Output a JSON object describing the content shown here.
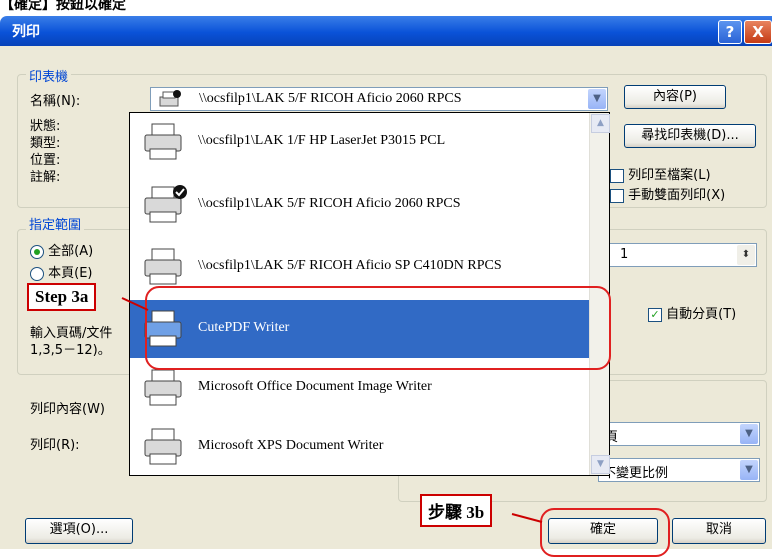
{
  "instruction_text": "【確定】按鈕以確定",
  "window": {
    "title": "列印",
    "help_btn": "?",
    "close_btn": "X"
  },
  "printer_group": {
    "title": "印表機",
    "name_label": "名稱(N):",
    "selected_printer": "\\\\ocsfilp1\\LAK 5/F RICOH Aficio 2060 RPCS",
    "properties_button": "內容(P)",
    "find_printer_button": "尋找印表機(D)...",
    "status_label": "狀態:",
    "type_label": "類型:",
    "location_label": "位置:",
    "comment_label": "註解:",
    "print_to_file": "列印至檔案(L)",
    "manual_duplex": "手動雙面列印(X)"
  },
  "range_group": {
    "title": "指定範圍",
    "all_option": "全部(A)",
    "current_option": "本頁(E)",
    "pages_hint_1": "輸入頁碼/文件",
    "pages_hint_2": "1,3,5－12)。"
  },
  "copies": {
    "value": "1",
    "collate_label": "自動分頁(T)"
  },
  "print_what": {
    "label": "列印內容(W)",
    "print_label": "列印(R):",
    "pages_value": "頁",
    "scale_value": "不變更比例"
  },
  "printers": [
    {
      "name": "\\\\ocsfilp1\\LAK 1/F HP LaserJet P3015 PCL",
      "icon": "printer-icon",
      "default": false,
      "selected": false
    },
    {
      "name": "\\\\ocsfilp1\\LAK 5/F RICOH Aficio 2060 RPCS",
      "icon": "printer-default-icon",
      "default": true,
      "selected": false
    },
    {
      "name": "\\\\ocsfilp1\\LAK 5/F RICOH Aficio SP C410DN RPCS",
      "icon": "printer-icon",
      "default": false,
      "selected": false
    },
    {
      "name": "CutePDF Writer",
      "icon": "printer-icon",
      "default": false,
      "selected": true
    },
    {
      "name": "Microsoft Office Document Image Writer",
      "icon": "printer-icon",
      "default": false,
      "selected": false
    },
    {
      "name": "Microsoft XPS Document Writer",
      "icon": "printer-icon",
      "default": false,
      "selected": false
    }
  ],
  "callouts": {
    "step3a": "Step 3a",
    "step3b": "步驟 3b"
  },
  "buttons": {
    "options": "選項(O)...",
    "ok": "確定",
    "cancel": "取消"
  },
  "colors": {
    "title_bar": "#0a52d8",
    "selection": "#316ac5",
    "highlight": "#e02020"
  }
}
